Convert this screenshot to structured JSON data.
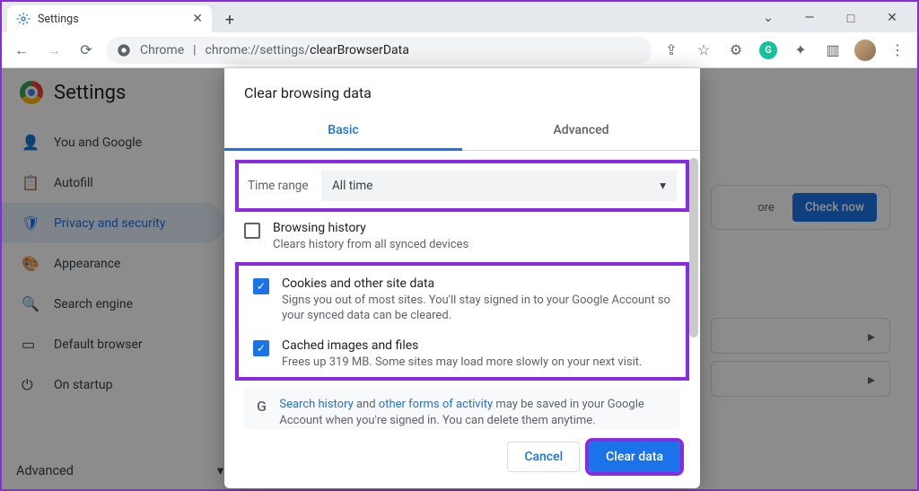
{
  "window": {
    "tab_title": "Settings",
    "minimize": "—",
    "maximize": "□",
    "close": "✕",
    "dropdown": "⌄"
  },
  "toolbar": {
    "back": "←",
    "forward": "→",
    "reload": "⟳",
    "chrome_label": "Chrome",
    "url_prefix": "chrome://settings/",
    "url_path": "clearBrowserData",
    "share": "⇪",
    "star": "☆",
    "menu": "⋮"
  },
  "settings": {
    "title": "Settings",
    "sidebar": [
      {
        "icon": "👤",
        "label": "You and Google"
      },
      {
        "icon": "📋",
        "label": "Autofill"
      },
      {
        "icon": "🛡",
        "label": "Privacy and security"
      },
      {
        "icon": "🎨",
        "label": "Appearance"
      },
      {
        "icon": "🔍",
        "label": "Search engine"
      },
      {
        "icon": "▭",
        "label": "Default browser"
      },
      {
        "icon": "⏻",
        "label": "On startup"
      }
    ],
    "advanced": "Advanced",
    "bg_more": "ore",
    "bg_checknow": "Check now"
  },
  "dialog": {
    "title": "Clear browsing data",
    "tabs": {
      "basic": "Basic",
      "advanced": "Advanced"
    },
    "time_label": "Time range",
    "time_value": "All time",
    "options": [
      {
        "checked": false,
        "title": "Browsing history",
        "desc": "Clears history from all synced devices"
      },
      {
        "checked": true,
        "title": "Cookies and other site data",
        "desc": "Signs you out of most sites. You'll stay signed in to your Google Account so your synced data can be cleared."
      },
      {
        "checked": true,
        "title": "Cached images and files",
        "desc": "Frees up 319 MB. Some sites may load more slowly on your next visit."
      }
    ],
    "info_link1": "Search history",
    "info_mid": " and ",
    "info_link2": "other forms of activity",
    "info_rest": " may be saved in your Google Account when you're signed in. You can delete them anytime.",
    "cancel": "Cancel",
    "clear": "Clear data"
  }
}
